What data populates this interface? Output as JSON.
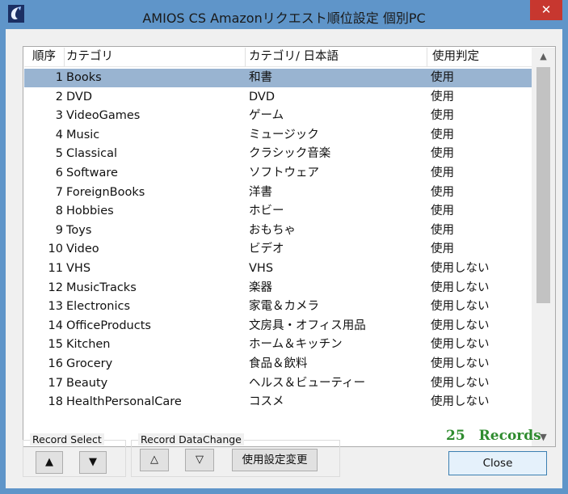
{
  "window": {
    "title": "AMIOS CS Amazonリクエスト順位設定 個別PC",
    "close_glyph": "✕"
  },
  "list": {
    "columns": [
      "順序",
      "カテゴリ",
      "カテゴリ/ 日本語",
      "使用判定"
    ],
    "selected_index": 0,
    "rows": [
      {
        "no": "1",
        "category": "Books",
        "japanese": "和書",
        "status": "使用"
      },
      {
        "no": "2",
        "category": "DVD",
        "japanese": "DVD",
        "status": "使用"
      },
      {
        "no": "3",
        "category": "VideoGames",
        "japanese": "ゲーム",
        "status": "使用"
      },
      {
        "no": "4",
        "category": "Music",
        "japanese": "ミュージック",
        "status": "使用"
      },
      {
        "no": "5",
        "category": "Classical",
        "japanese": "クラシック音楽",
        "status": "使用"
      },
      {
        "no": "6",
        "category": "Software",
        "japanese": "ソフトウェア",
        "status": "使用"
      },
      {
        "no": "7",
        "category": "ForeignBooks",
        "japanese": "洋書",
        "status": "使用"
      },
      {
        "no": "8",
        "category": "Hobbies",
        "japanese": "ホビー",
        "status": "使用"
      },
      {
        "no": "9",
        "category": "Toys",
        "japanese": "おもちゃ",
        "status": "使用"
      },
      {
        "no": "10",
        "category": "Video",
        "japanese": "ビデオ",
        "status": "使用"
      },
      {
        "no": "11",
        "category": "VHS",
        "japanese": "VHS",
        "status": "使用しない"
      },
      {
        "no": "12",
        "category": "MusicTracks",
        "japanese": "楽器",
        "status": "使用しない"
      },
      {
        "no": "13",
        "category": "Electronics",
        "japanese": "家電＆カメラ",
        "status": "使用しない"
      },
      {
        "no": "14",
        "category": "OfficeProducts",
        "japanese": "文房具・オフィス用品",
        "status": "使用しない"
      },
      {
        "no": "15",
        "category": "Kitchen",
        "japanese": "ホーム＆キッチン",
        "status": "使用しない"
      },
      {
        "no": "16",
        "category": "Grocery",
        "japanese": "食品＆飲料",
        "status": "使用しない"
      },
      {
        "no": "17",
        "category": "Beauty",
        "japanese": "ヘルス＆ビューティー",
        "status": "使用しない"
      },
      {
        "no": "18",
        "category": "HealthPersonalCare",
        "japanese": "コスメ",
        "status": "使用しない"
      }
    ]
  },
  "record_select": {
    "label": "Record Select",
    "up_glyph": "▲",
    "down_glyph": "▼"
  },
  "record_datachange": {
    "label": "Record DataChange",
    "up_glyph": "△",
    "down_glyph": "▽",
    "change_label": "使用設定変更"
  },
  "records_count": "25　Records",
  "close_button": "Close",
  "colors": {
    "selection": "#99b4d1",
    "records_text": "#2e8b2e",
    "close_red": "#c7372f",
    "frame": "#5f95c9"
  }
}
